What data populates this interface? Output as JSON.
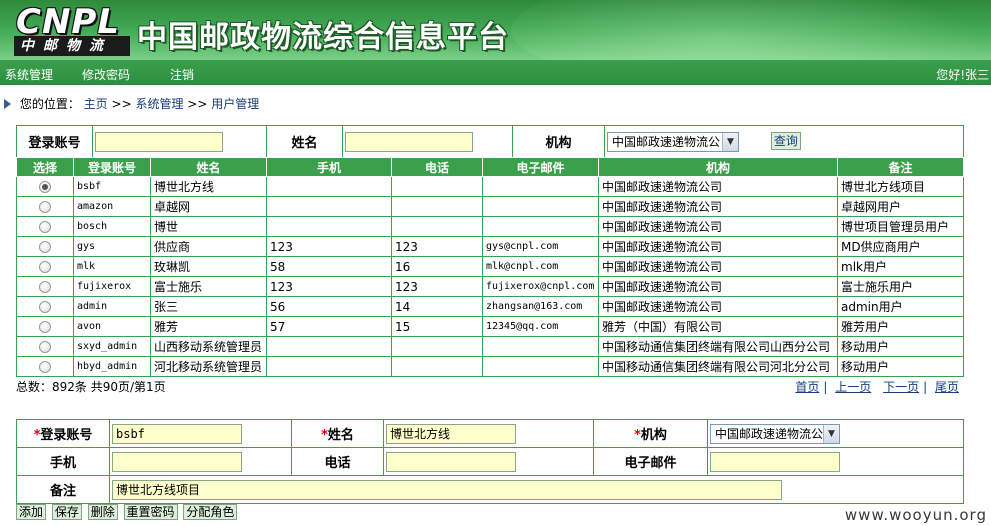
{
  "header": {
    "logo_text": "CNPL",
    "logo_sub": "中邮物流",
    "site_title": "中国邮政物流综合信息平台"
  },
  "nav": {
    "items": [
      "系统管理",
      "修改密码",
      "注销"
    ],
    "greeting": "您好!张三"
  },
  "breadcrumb": {
    "prefix": "您的位置：",
    "home": "主页",
    "sep1": ">>",
    "level1": "系统管理",
    "sep2": ">>",
    "level2": "用户管理"
  },
  "search": {
    "account_label": "登录账号",
    "account_value": "",
    "name_label": "姓名",
    "name_value": "",
    "org_label": "机构",
    "org_selected": "中国邮政速递物流公",
    "query_button": "查询"
  },
  "grid": {
    "columns": [
      "选择",
      "登录账号",
      "姓名",
      "手机",
      "电话",
      "电子邮件",
      "机构",
      "备注"
    ],
    "rows": [
      {
        "account": "bsbf",
        "name": "博世北方线",
        "mobile": "",
        "phone": "",
        "email": "",
        "org": "中国邮政速递物流公司",
        "note": "博世北方线项目",
        "checked": true
      },
      {
        "account": "amazon",
        "name": "卓越网",
        "mobile": "",
        "phone": "",
        "email": "",
        "org": "中国邮政速递物流公司",
        "note": "卓越网用户",
        "checked": false
      },
      {
        "account": "bosch",
        "name": "博世",
        "mobile": "",
        "phone": "",
        "email": "",
        "org": "中国邮政速递物流公司",
        "note": "博世项目管理员用户",
        "checked": false
      },
      {
        "account": "gys",
        "name": "供应商",
        "mobile": "123",
        "phone": "123",
        "email": "gys@cnpl.com",
        "org": "中国邮政速递物流公司",
        "note": "MD供应商用户",
        "checked": false
      },
      {
        "account": "mlk",
        "name": "玫琳凯",
        "mobile": "58",
        "phone": "16",
        "email": "mlk@cnpl.com",
        "org": "中国邮政速递物流公司",
        "note": "mlk用户",
        "checked": false
      },
      {
        "account": "fujixerox",
        "name": "富士施乐",
        "mobile": "123",
        "phone": "123",
        "email": "fujixerox@cnpl.com",
        "org": "中国邮政速递物流公司",
        "note": "富士施乐用户",
        "checked": false
      },
      {
        "account": "admin",
        "name": "张三",
        "mobile": "56",
        "phone": "14",
        "email": "zhangsan@163.com",
        "org": "中国邮政速递物流公司",
        "note": "admin用户",
        "checked": false
      },
      {
        "account": "avon",
        "name": "雅芳",
        "mobile": "57",
        "phone": "15",
        "email": "12345@qq.com",
        "org": "雅芳（中国）有限公司",
        "note": "雅芳用户",
        "checked": false
      },
      {
        "account": "sxyd_admin",
        "name": "山西移动系统管理员",
        "mobile": "",
        "phone": "",
        "email": "",
        "org": "中国移动通信集团终端有限公司山西分公司",
        "note": "移动用户",
        "checked": false
      },
      {
        "account": "hbyd_admin",
        "name": "河北移动系统管理员",
        "mobile": "",
        "phone": "",
        "email": "",
        "org": "中国移动通信集团终端有限公司河北分公司",
        "note": "移动用户",
        "checked": false
      }
    ]
  },
  "pager": {
    "summary": "总数：892条   共90页/第1页",
    "first": "首页",
    "prev": "上一页",
    "next": "下一页",
    "last": "尾页"
  },
  "edit": {
    "required_mark": "*",
    "account_label": "登录账号",
    "account_value": "bsbf",
    "name_label": "姓名",
    "name_value": "博世北方线",
    "org_label": "机构",
    "org_selected": "中国邮政速递物流公",
    "mobile_label": "手机",
    "mobile_value": "",
    "phone_label": "电话",
    "phone_value": "",
    "email_label": "电子邮件",
    "email_value": "",
    "note_label": "备注",
    "note_value": "博世北方线项目"
  },
  "actions": {
    "add": "添加",
    "save": "保存",
    "delete": "删除",
    "reset_password": "重置密码",
    "assign_role": "分配角色"
  },
  "watermark": "www.wooyun.org"
}
